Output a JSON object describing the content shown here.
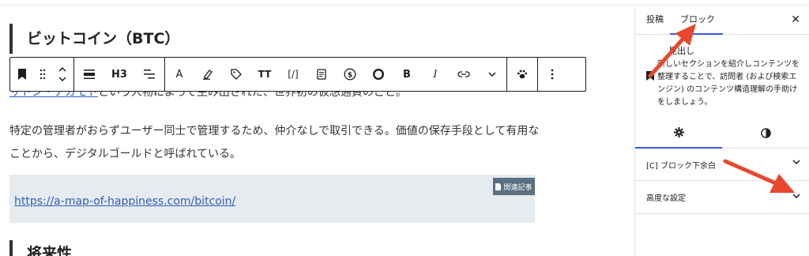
{
  "editor": {
    "heading": "ビットコイン（BTC）",
    "partial_line_link": "サトシ・ナカモト",
    "partial_line_rest": "という人物によって生み出された、世界初の仮想通貨のこと。",
    "paragraph": "特定の管理者がおらずユーザー同士で管理するため、仲介なしで取引できる。価値の保存手段として有用なことから、デジタルゴールドと呼ばれている。",
    "related_badge": "関連記事",
    "related_url": "https://a-map-of-happiness.com/bitcoin/",
    "next_heading": "将来性"
  },
  "toolbar": {
    "heading_level": "H3",
    "text_color_label": "A",
    "font_size_label": "TT",
    "code_label": "[/]",
    "bold_label": "B",
    "italic_label": "I"
  },
  "sidebar": {
    "tabs": [
      "投稿",
      "ブロック"
    ],
    "active_tab": "ブロック",
    "block_name": "見出し",
    "block_description": "新しいセクションを紹介しコンテンツを整理することで、訪問者 (および検索エンジン) のコンテンツ構造理解の手助けをしましょう。",
    "panels": [
      "[C] ブロック下余白",
      "高度な設定"
    ]
  },
  "colors": {
    "accent": "#3858e9",
    "link": "#2f5fb3",
    "annotation_arrow": "#e8472f",
    "related_bg": "#e6ebf0",
    "badge_bg": "#5a6f80"
  }
}
